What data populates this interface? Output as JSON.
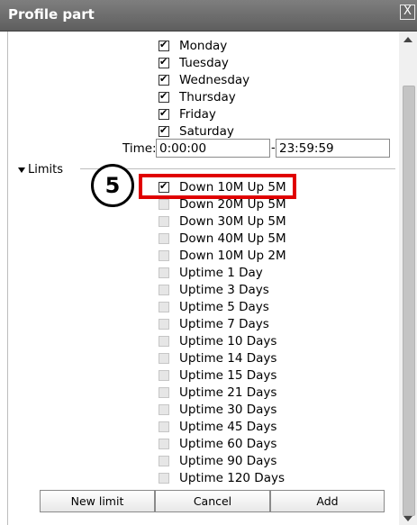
{
  "window": {
    "title": "Profile part",
    "close_glyph": "X"
  },
  "days": [
    {
      "label": "Monday",
      "checked": true
    },
    {
      "label": "Tuesday",
      "checked": true
    },
    {
      "label": "Wednesday",
      "checked": true
    },
    {
      "label": "Thursday",
      "checked": true
    },
    {
      "label": "Friday",
      "checked": true
    },
    {
      "label": "Saturday",
      "checked": true
    }
  ],
  "time": {
    "label": "Time:",
    "from": "0:00:00",
    "separator": "-",
    "to": "23:59:59"
  },
  "limits": {
    "label": "Limits",
    "step_number": "5",
    "items": [
      {
        "label": "Down 10M Up 5M",
        "checked": true
      },
      {
        "label": "Down 20M Up 5M",
        "checked": false
      },
      {
        "label": "Down 30M Up 5M",
        "checked": false
      },
      {
        "label": "Down 40M Up 5M",
        "checked": false
      },
      {
        "label": "Down 10M Up 2M",
        "checked": false
      },
      {
        "label": "Uptime 1 Day",
        "checked": false
      },
      {
        "label": "Uptime 3 Days",
        "checked": false
      },
      {
        "label": "Uptime 5 Days",
        "checked": false
      },
      {
        "label": "Uptime 7 Days",
        "checked": false
      },
      {
        "label": "Uptime 10 Days",
        "checked": false
      },
      {
        "label": "Uptime 14 Days",
        "checked": false
      },
      {
        "label": "Uptime 15 Days",
        "checked": false
      },
      {
        "label": "Uptime 21 Days",
        "checked": false
      },
      {
        "label": "Uptime 30 Days",
        "checked": false
      },
      {
        "label": "Uptime 45 Days",
        "checked": false
      },
      {
        "label": "Uptime 60 Days",
        "checked": false
      },
      {
        "label": "Uptime 90 Days",
        "checked": false
      },
      {
        "label": "Uptime 120 Days",
        "checked": false
      }
    ]
  },
  "buttons": {
    "new_limit": "New limit",
    "cancel": "Cancel",
    "add": "Add"
  },
  "colors": {
    "highlight": "#e00000",
    "titlebar": "#6a6a6a"
  }
}
